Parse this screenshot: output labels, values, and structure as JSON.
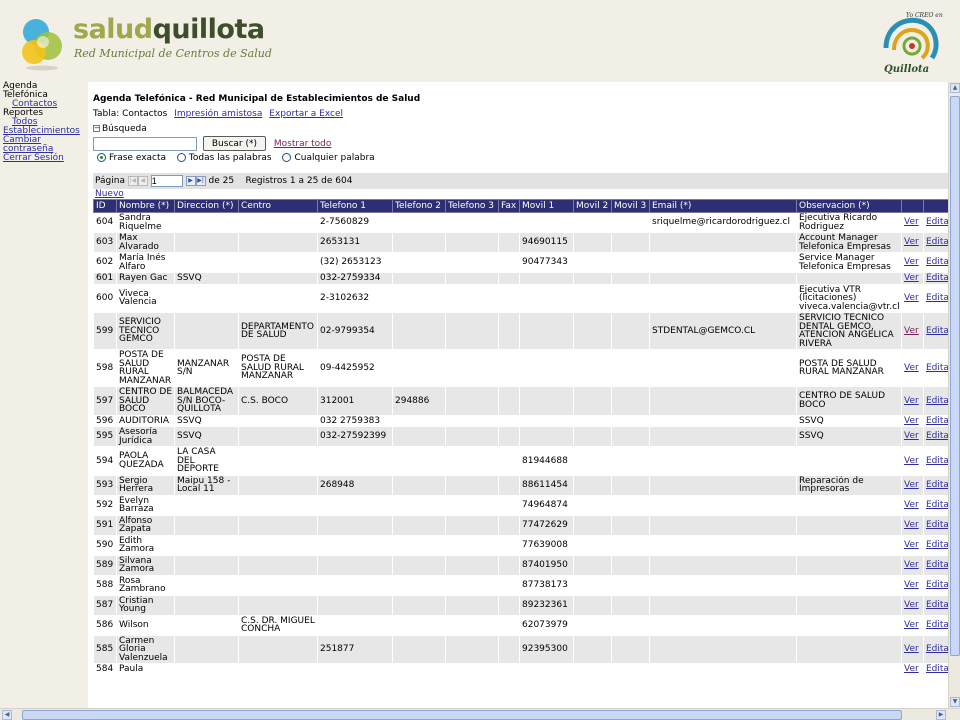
{
  "header": {
    "brand_light": "salud",
    "brand_dark": "quillota",
    "subtitle": "Red Municipal de Centros de Salud",
    "seal_text": "Yo CREO en Quillota"
  },
  "nav": {
    "agenda_label": "Agenda Telefónica",
    "contactos": "Contactos",
    "reportes_label": "Reportes",
    "todos": "Todos",
    "establecimientos": "Establecimientos",
    "cambiar": "Cambiar contraseña",
    "cerrar": "Cerrar Sesión"
  },
  "page": {
    "title": "Agenda Telefónica - Red Municipal de Establecimientos de Salud",
    "table_label": "Tabla: Contactos",
    "print_link": "Impresión amistosa",
    "excel_link": "Exportar a Excel",
    "search_section": "Búsqueda",
    "search_value": "",
    "search_button": "Buscar (*)",
    "show_all": "Mostrar todo",
    "radio_exact": "Frase exacta",
    "radio_all": "Todas las palabras",
    "radio_any": "Cualquier palabra"
  },
  "pager": {
    "page_label": "Página",
    "page_value": "1",
    "of_label": "de 25",
    "records": "Registros 1 a 25 de 604",
    "new_link": "Nuevo"
  },
  "columns": [
    "ID",
    "Nombre (*)",
    "Direccion (*)",
    "Centro",
    "Telefono 1",
    "Telefono 2",
    "Telefono 3",
    "Fax",
    "Movil 1",
    "Movil 2",
    "Movil 3",
    "Email (*)",
    "Observacion (*)",
    "",
    ""
  ],
  "row_link_view": "Ver",
  "row_link_edit": "Editar",
  "rows": [
    {
      "id": "604",
      "nombre": "Sandra Riquelme",
      "direccion": "",
      "centro": "",
      "tel1": "2-7560829",
      "tel2": "",
      "tel3": "",
      "fax": "",
      "movil1": "",
      "movil2": "",
      "movil3": "",
      "email": "sriquelme@ricardorodriguez.cl",
      "obs": "Ejecutiva Ricardo Rodriguez"
    },
    {
      "id": "603",
      "nombre": "Max Alvarado",
      "direccion": "",
      "centro": "",
      "tel1": "2653131",
      "tel2": "",
      "tel3": "",
      "fax": "",
      "movil1": "94690115",
      "movil2": "",
      "movil3": "",
      "email": "",
      "obs": "Account Manager Telefonica Empresas"
    },
    {
      "id": "602",
      "nombre": "María Inés Alfaro",
      "direccion": "",
      "centro": "",
      "tel1": "(32) 2653123",
      "tel2": "",
      "tel3": "",
      "fax": "",
      "movil1": "90477343",
      "movil2": "",
      "movil3": "",
      "email": "",
      "obs": "Service Manager Telefonica Empresas"
    },
    {
      "id": "601",
      "nombre": "Rayen Gac",
      "direccion": "SSVQ",
      "centro": "",
      "tel1": "032-2759334",
      "tel2": "",
      "tel3": "",
      "fax": "",
      "movil1": "",
      "movil2": "",
      "movil3": "",
      "email": "",
      "obs": ""
    },
    {
      "id": "600",
      "nombre": "Viveca Valencia",
      "direccion": "",
      "centro": "",
      "tel1": "2-3102632",
      "tel2": "",
      "tel3": "",
      "fax": "",
      "movil1": "",
      "movil2": "",
      "movil3": "",
      "email": "",
      "obs": "Ejecutiva VTR (licitaciones) viveca.valencia@vtr.cl"
    },
    {
      "id": "599",
      "nombre": "SERVICIO TECNICO GEMCO",
      "direccion": "",
      "centro": "DEPARTAMENTO DE SALUD",
      "tel1": "02-9799354",
      "tel2": "",
      "tel3": "",
      "fax": "",
      "movil1": "",
      "movil2": "",
      "movil3": "",
      "email": "STDENTAL@GEMCO.CL",
      "obs": "SERVICIO TECNICO DENTAL GEMCO, ATENCION ANGELICA RIVERA"
    },
    {
      "id": "598",
      "nombre": "POSTA DE SALUD RURAL MANZANAR",
      "direccion": "MANZANAR S/N",
      "centro": "POSTA DE SALUD RURAL MANZANAR",
      "tel1": "09-4425952",
      "tel2": "",
      "tel3": "",
      "fax": "",
      "movil1": "",
      "movil2": "",
      "movil3": "",
      "email": "",
      "obs": "POSTA DE SALUD RURAL MANZANAR"
    },
    {
      "id": "597",
      "nombre": "CENTRO DE SALUD BOCO",
      "direccion": "BALMACEDA S/N BOCO-QUILLOTA",
      "centro": "C.S. BOCO",
      "tel1": "312001",
      "tel2": "294886",
      "tel3": "",
      "fax": "",
      "movil1": "",
      "movil2": "",
      "movil3": "",
      "email": "",
      "obs": "CENTRO DE SALUD BOCO"
    },
    {
      "id": "596",
      "nombre": "AUDITORIA",
      "direccion": "SSVQ",
      "centro": "",
      "tel1": "032 2759383",
      "tel2": "",
      "tel3": "",
      "fax": "",
      "movil1": "",
      "movil2": "",
      "movil3": "",
      "email": "",
      "obs": "SSVQ"
    },
    {
      "id": "595",
      "nombre": "Asesoría Jurídica",
      "direccion": "SSVQ",
      "centro": "",
      "tel1": "032-27592399",
      "tel2": "",
      "tel3": "",
      "fax": "",
      "movil1": "",
      "movil2": "",
      "movil3": "",
      "email": "",
      "obs": "SSVQ"
    },
    {
      "id": "594",
      "nombre": "PAOLA QUEZADA",
      "direccion": "LA CASA DEL DEPORTE",
      "centro": "",
      "tel1": "",
      "tel2": "",
      "tel3": "",
      "fax": "",
      "movil1": "81944688",
      "movil2": "",
      "movil3": "",
      "email": "",
      "obs": ""
    },
    {
      "id": "593",
      "nombre": "Sergio Herrera",
      "direccion": "Maipu 158 - Local 11",
      "centro": "",
      "tel1": "268948",
      "tel2": "",
      "tel3": "",
      "fax": "",
      "movil1": "88611454",
      "movil2": "",
      "movil3": "",
      "email": "",
      "obs": "Reparación de Impresoras"
    },
    {
      "id": "592",
      "nombre": "Evelyn Barraza",
      "direccion": "",
      "centro": "",
      "tel1": "",
      "tel2": "",
      "tel3": "",
      "fax": "",
      "movil1": "74964874",
      "movil2": "",
      "movil3": "",
      "email": "",
      "obs": ""
    },
    {
      "id": "591",
      "nombre": "Alfonso Zapata",
      "direccion": "",
      "centro": "",
      "tel1": "",
      "tel2": "",
      "tel3": "",
      "fax": "",
      "movil1": "77472629",
      "movil2": "",
      "movil3": "",
      "email": "",
      "obs": ""
    },
    {
      "id": "590",
      "nombre": "Edith Zamora",
      "direccion": "",
      "centro": "",
      "tel1": "",
      "tel2": "",
      "tel3": "",
      "fax": "",
      "movil1": "77639008",
      "movil2": "",
      "movil3": "",
      "email": "",
      "obs": ""
    },
    {
      "id": "589",
      "nombre": "Silvana Zamora",
      "direccion": "",
      "centro": "",
      "tel1": "",
      "tel2": "",
      "tel3": "",
      "fax": "",
      "movil1": "87401950",
      "movil2": "",
      "movil3": "",
      "email": "",
      "obs": ""
    },
    {
      "id": "588",
      "nombre": "Rosa Zambrano",
      "direccion": "",
      "centro": "",
      "tel1": "",
      "tel2": "",
      "tel3": "",
      "fax": "",
      "movil1": "87738173",
      "movil2": "",
      "movil3": "",
      "email": "",
      "obs": ""
    },
    {
      "id": "587",
      "nombre": "Cristian Young",
      "direccion": "",
      "centro": "",
      "tel1": "",
      "tel2": "",
      "tel3": "",
      "fax": "",
      "movil1": "89232361",
      "movil2": "",
      "movil3": "",
      "email": "",
      "obs": ""
    },
    {
      "id": "586",
      "nombre": "Wilson",
      "direccion": "",
      "centro": "C.S. DR. MIGUEL CONCHA",
      "tel1": "",
      "tel2": "",
      "tel3": "",
      "fax": "",
      "movil1": "62073979",
      "movil2": "",
      "movil3": "",
      "email": "",
      "obs": ""
    },
    {
      "id": "585",
      "nombre": "Carmen Gloria Valenzuela",
      "direccion": "",
      "centro": "",
      "tel1": "251877",
      "tel2": "",
      "tel3": "",
      "fax": "",
      "movil1": "92395300",
      "movil2": "",
      "movil3": "",
      "email": "",
      "obs": ""
    },
    {
      "id": "584",
      "nombre": "Paula",
      "direccion": "",
      "centro": "",
      "tel1": "",
      "tel2": "",
      "tel3": "",
      "fax": "",
      "movil1": "",
      "movil2": "",
      "movil3": "",
      "email": "",
      "obs": ""
    }
  ],
  "colors": {
    "header_bg": "#2e2e74",
    "row_alt": "#e7e7e7",
    "link": "#2e2ea0",
    "visited": "#7a1e58",
    "brand": "#9fa84a"
  }
}
